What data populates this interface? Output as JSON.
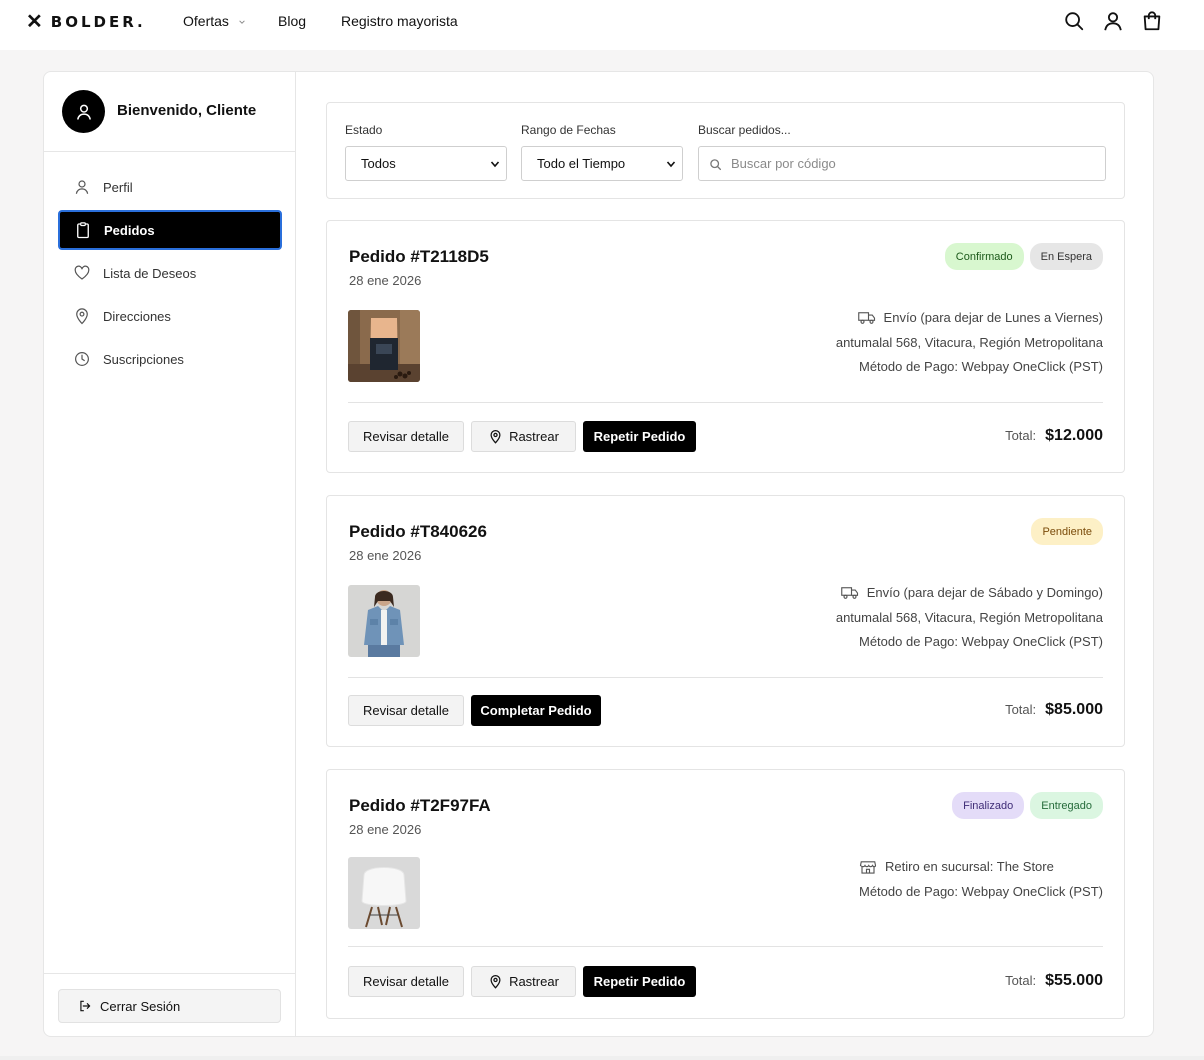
{
  "header": {
    "brand": "BOLDER.",
    "nav": [
      "Ofertas",
      "Blog",
      "Registro mayorista"
    ],
    "icons": [
      "search-icon",
      "user-icon",
      "cart-icon"
    ]
  },
  "sidebar": {
    "welcome": "Bienvenido, Cliente",
    "items": [
      {
        "label": "Perfil",
        "icon": "user-icon"
      },
      {
        "label": "Pedidos",
        "icon": "clipboard-icon"
      },
      {
        "label": "Lista de Deseos",
        "icon": "heart-icon"
      },
      {
        "label": "Direcciones",
        "icon": "map-pin-icon"
      },
      {
        "label": "Suscripciones",
        "icon": "clock-icon"
      }
    ],
    "active": "Pedidos",
    "logout": "Cerrar Sesión"
  },
  "filters": {
    "estado_label": "Estado",
    "estado_value": "Todos",
    "rango_label": "Rango de Fechas",
    "rango_value": "Todo el Tiempo",
    "buscar_label": "Buscar pedidos...",
    "buscar_placeholder": "Buscar por código"
  },
  "orders": [
    {
      "title": "Pedido #T2118D5",
      "date": "28 ene 2026",
      "badges": [
        "Confirmado",
        "En Espera"
      ],
      "shipping": "Envío (para dejar de Lunes a Viernes)",
      "address": "antumalal 568, Vitacura, Región Metropolitana",
      "payment": "Método de Pago: Webpay OneClick (PST)",
      "buttons": [
        "Revisar detalle",
        "Rastrear",
        "Repetir Pedido"
      ],
      "total_label": "Total:",
      "total": "$12.000",
      "image": "coffee-bag"
    },
    {
      "title": "Pedido #T840626",
      "date": "28 ene 2026",
      "badges": [
        "Pendiente"
      ],
      "shipping": "Envío (para dejar de Sábado y Domingo)",
      "address": "antumalal 568, Vitacura, Región Metropolitana",
      "payment": "Método de Pago: Webpay OneClick (PST)",
      "buttons": [
        "Revisar detalle",
        "Completar Pedido"
      ],
      "total_label": "Total:",
      "total": "$85.000",
      "image": "denim-jacket"
    },
    {
      "title": "Pedido #T2F97FA",
      "date": "28 ene 2026",
      "badges": [
        "Finalizado",
        "Entregado"
      ],
      "shipping": "Retiro en sucursal: The Store",
      "payment": "Método de Pago: Webpay OneClick (PST)",
      "buttons": [
        "Revisar detalle",
        "Rastrear",
        "Repetir Pedido"
      ],
      "total_label": "Total:",
      "total": "$55.000",
      "image": "white-chair"
    }
  ],
  "colors": {
    "accent": "#000000",
    "focus_ring": "#2a6fdb",
    "badge_confirmado": "#d8f7cf",
    "badge_pendiente": "#fdf0c6",
    "badge_finalizado": "#e4dcf8",
    "badge_entregado": "#dbf6e1"
  }
}
